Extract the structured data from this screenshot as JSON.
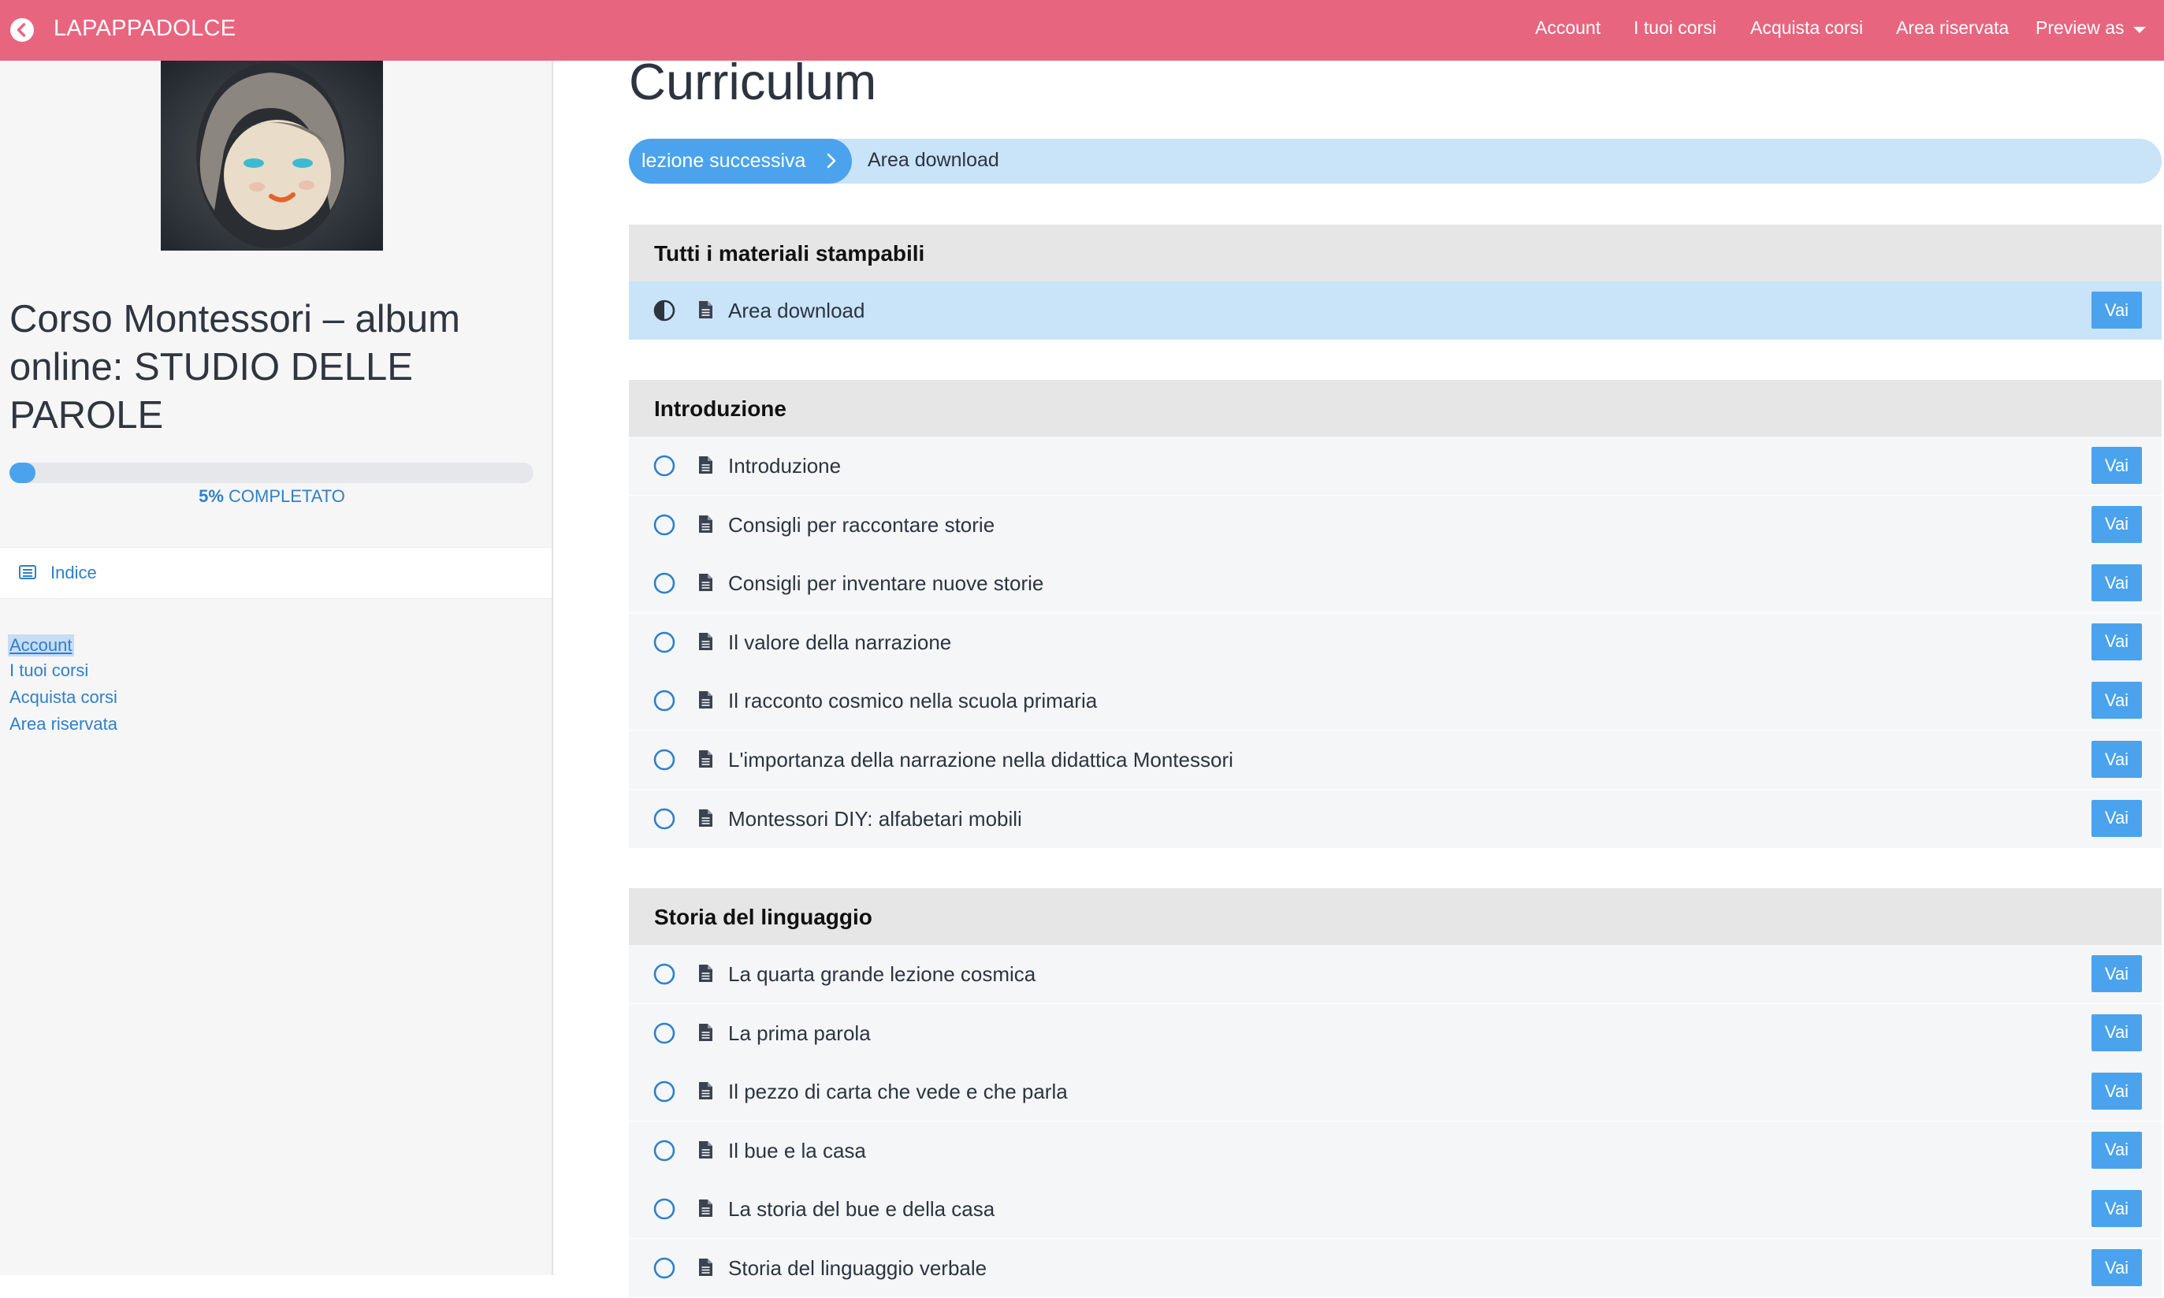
{
  "topbar": {
    "brand": "LAPAPPADOLCE",
    "nav": [
      "Account",
      "I tuoi corsi",
      "Acquista corsi",
      "Area riservata",
      "Preview as"
    ],
    "color": "#e8657f"
  },
  "sidebar": {
    "course_title": "Corso Montessori – album online: STUDIO DELLE PAROLE",
    "progress": {
      "percent": 5,
      "percent_text": "5%",
      "label": "COMPLETATO"
    },
    "index_label": "Indice",
    "links": [
      "Account",
      "I tuoi corsi",
      "Acquista corsi",
      "Area riservata"
    ]
  },
  "main": {
    "title": "Curriculum",
    "next_button": "lezione successiva",
    "next_lesson": "Area download",
    "action_label": "Vai",
    "sections": [
      {
        "title": "Tutti i materiali stampabili",
        "lessons": [
          {
            "label": "Area download",
            "status": "in-progress"
          }
        ]
      },
      {
        "title": "Introduzione",
        "lessons": [
          {
            "label": "Introduzione",
            "status": "not-started"
          },
          {
            "label": "Consigli per raccontare storie",
            "status": "not-started"
          },
          {
            "label": "Consigli per inventare nuove storie",
            "status": "not-started"
          },
          {
            "label": "Il valore della narrazione",
            "status": "not-started"
          },
          {
            "label": "Il racconto cosmico nella scuola primaria",
            "status": "not-started"
          },
          {
            "label": "L'importanza della narrazione nella didattica Montessori",
            "status": "not-started"
          },
          {
            "label": "Montessori DIY: alfabetari mobili",
            "status": "not-started"
          }
        ]
      },
      {
        "title": "Storia del linguaggio",
        "lessons": [
          {
            "label": "La quarta grande lezione cosmica",
            "status": "not-started"
          },
          {
            "label": "La prima parola",
            "status": "not-started"
          },
          {
            "label": "Il pezzo di carta che vede e che parla",
            "status": "not-started"
          },
          {
            "label": "Il bue e la casa",
            "status": "not-started"
          },
          {
            "label": "La storia del bue e della casa",
            "status": "not-started"
          },
          {
            "label": "Storia del linguaggio verbale",
            "status": "not-started"
          }
        ]
      }
    ]
  },
  "colors": {
    "accent": "#4aa3ec",
    "accent_light": "#c9e3f9",
    "link": "#2f80c8"
  }
}
